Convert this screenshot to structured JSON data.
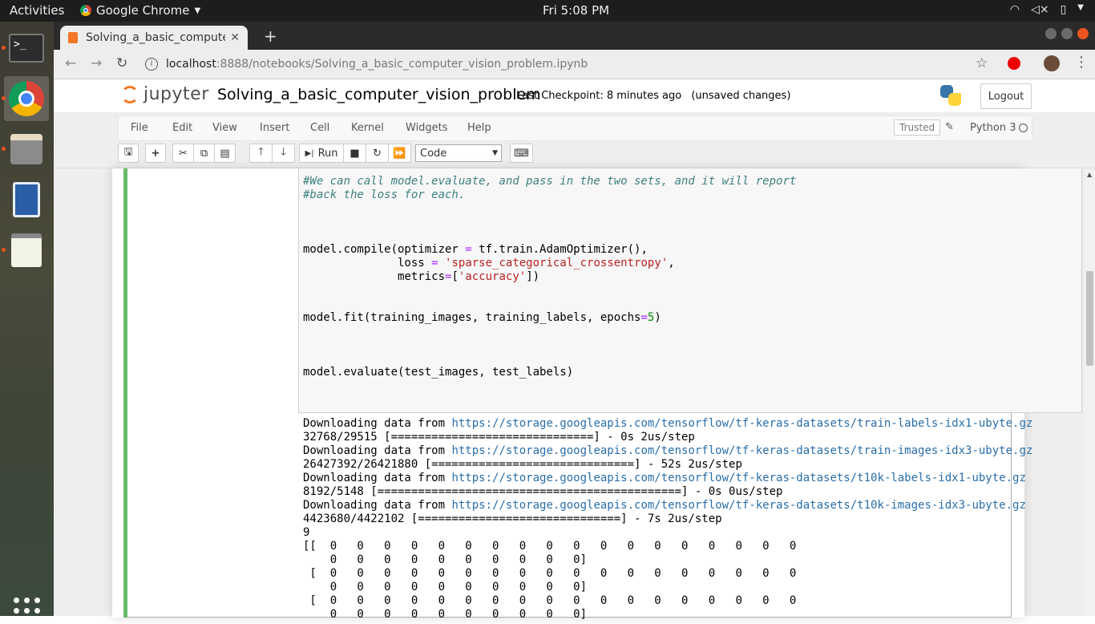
{
  "desktop": {
    "activities": "Activities",
    "app_name": "Google Chrome",
    "clock": "Fri  5:08 PM"
  },
  "browser": {
    "tab_title": "Solving_a_basic_computer_vision_problem",
    "url_host": "localhost",
    "url_rest": ":8888/notebooks/Solving_a_basic_computer_vision_problem.ipynb"
  },
  "jupyter": {
    "logo_text": "jupyter",
    "notebook_name": "Solving_a_basic_computer_vision_problem",
    "checkpoint": "Last Checkpoint: 8 minutes ago",
    "unsaved": "(unsaved changes)",
    "logout": "Logout",
    "menu": [
      "File",
      "Edit",
      "View",
      "Insert",
      "Cell",
      "Kernel",
      "Widgets",
      "Help"
    ],
    "trusted": "Trusted",
    "kernel": "Python 3",
    "run_label": "Run",
    "cell_type": "Code"
  },
  "code": {
    "comment1": "#We can call model.evaluate, and pass in the two sets, and it will report",
    "comment2": "#back the loss for each.",
    "compile1a": "model.compile(optimizer ",
    "compile1b": "=",
    "compile1c": " tf.train.AdamOptimizer(),",
    "compile2a": "              loss ",
    "compile2b": "=",
    "compile2c": " ",
    "compile2d": "'sparse_categorical_crossentropy'",
    "compile2e": ",",
    "compile3a": "              metrics",
    "compile3b": "=",
    "compile3c": "[",
    "compile3d": "'accuracy'",
    "compile3e": "])",
    "fit_a": "model.fit(training_images, training_labels, epochs",
    "fit_b": "=",
    "fit_c": "5",
    "fit_d": ")",
    "evaluate": "model.evaluate(test_images, test_labels)"
  },
  "output": {
    "dl_prefix": "Downloading data from ",
    "url1": "https://storage.googleapis.com/tensorflow/tf-keras-datasets/train-labels-idx1-ubyte.gz",
    "prog1": "32768/29515 [==============================] - 0s 2us/step",
    "url2": "https://storage.googleapis.com/tensorflow/tf-keras-datasets/train-images-idx3-ubyte.gz",
    "prog2": "26427392/26421880 [==============================] - 52s 2us/step",
    "url3": "https://storage.googleapis.com/tensorflow/tf-keras-datasets/t10k-labels-idx1-ubyte.gz",
    "prog3": "8192/5148 [=============================================] - 0s 0us/step",
    "url4": "https://storage.googleapis.com/tensorflow/tf-keras-datasets/t10k-images-idx3-ubyte.gz",
    "prog4": "4423680/4422102 [==============================] - 7s 2us/step",
    "label": "9",
    "arr1": "[[  0   0   0   0   0   0   0   0   0   0   0   0   0   0   0   0   0   0",
    "arr2": "    0   0   0   0   0   0   0   0   0   0]",
    "arr3": " [  0   0   0   0   0   0   0   0   0   0   0   0   0   0   0   0   0   0",
    "arr4": "    0   0   0   0   0   0   0   0   0   0]",
    "arr5": " [  0   0   0   0   0   0   0   0   0   0   0   0   0   0   0   0   0   0",
    "arr6": "    0   0   0   0   0   0   0   0   0   0]"
  },
  "icons": {
    "terminal": "terminal-icon",
    "chrome": "chrome-icon",
    "files": "files-icon",
    "writer": "document-icon",
    "text_editor": "text-editor-icon",
    "apps": "apps-grid-icon"
  },
  "colors": {
    "cell_selected": "#66bb6a",
    "comment": "#408080",
    "string": "#ba2121",
    "number": "#008800",
    "link": "#296eaa"
  }
}
